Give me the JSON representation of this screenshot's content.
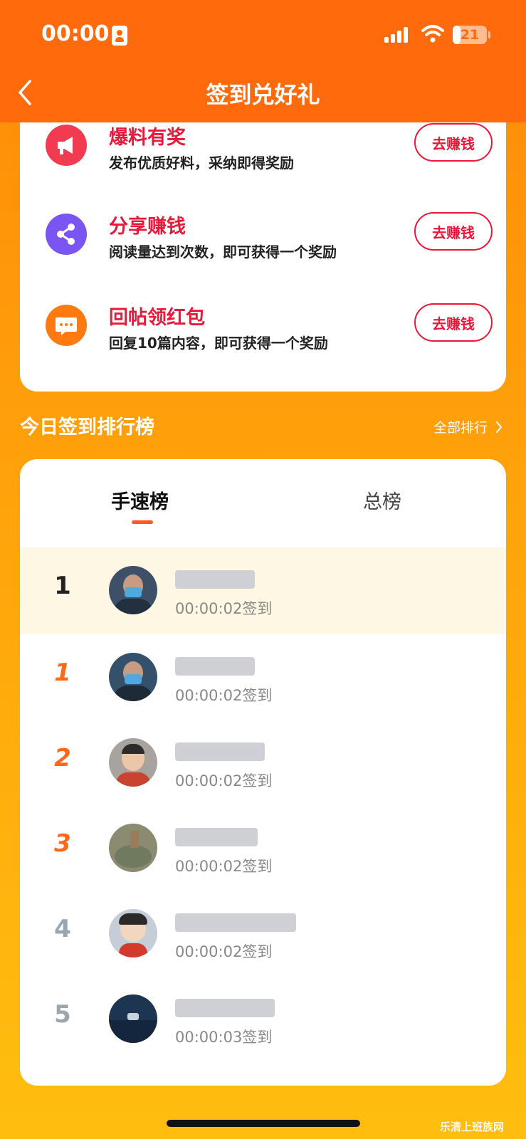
{
  "status_bar": {
    "time": "00:00",
    "battery": "21"
  },
  "header": {
    "title": "签到兑好礼"
  },
  "tasks": [
    {
      "title": "爆料有奖",
      "desc": "发布优质好料，采纳即得奖励",
      "button": "去赚钱",
      "icon": "megaphone-icon",
      "color": "#F23A50"
    },
    {
      "title": "分享赚钱",
      "desc": "阅读量达到次数，即可获得一个奖励",
      "button": "去赚钱",
      "icon": "share-icon",
      "color": "#7A55F2"
    },
    {
      "title": "回帖领红包",
      "desc": "回复10篇内容，即可获得一个奖励",
      "button": "去赚钱",
      "icon": "comment-icon",
      "color": "#FF7A10"
    }
  ],
  "ranking": {
    "section_title": "今日签到排行榜",
    "all_link": "全部排行",
    "tabs": [
      "手速榜",
      "总榜"
    ],
    "active_tab": "手速榜",
    "rows": [
      {
        "rank": "1",
        "time": "00:00:02签到",
        "avatar_color": "#3D5068"
      },
      {
        "rank": "1",
        "time": "00:00:02签到",
        "avatar_color": "#35506B"
      },
      {
        "rank": "2",
        "time": "00:00:02签到",
        "avatar_color": "#A8A39E"
      },
      {
        "rank": "3",
        "time": "00:00:02签到",
        "avatar_color": "#8B8B72"
      },
      {
        "rank": "4",
        "time": "00:00:02签到",
        "avatar_color": "#C6CDD6"
      },
      {
        "rank": "5",
        "time": "00:00:03签到",
        "avatar_color": "#1E3552"
      }
    ]
  },
  "watermark": "乐清上班族网"
}
